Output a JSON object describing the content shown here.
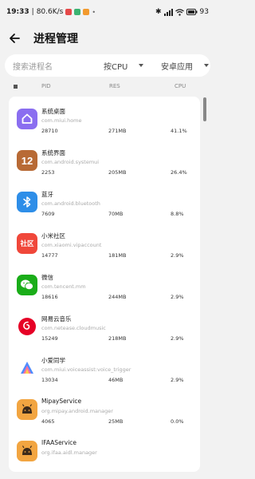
{
  "status": {
    "time": "19:33",
    "speed": "80.6K/s",
    "battery": "93"
  },
  "appbar": {
    "title": "进程管理"
  },
  "filter": {
    "search_placeholder": "搜索进程名",
    "sort_label": "按CPU",
    "type_label": "安卓应用"
  },
  "columns": {
    "pid": "PID",
    "res": "RES",
    "cpu": "CPU"
  },
  "colors": {
    "accent": "#1e88e5",
    "background": "#f2f2f2",
    "card": "#ffffff"
  },
  "processes": [
    {
      "name": "系统桌面",
      "package": "com.miui.home",
      "pid": "28710",
      "res": "271MB",
      "cpu": "41.1%",
      "icon": "home-icon"
    },
    {
      "name": "系统界面",
      "package": "com.android.systemui",
      "pid": "2253",
      "res": "205MB",
      "cpu": "26.4%",
      "icon": "systemui-icon"
    },
    {
      "name": "蓝牙",
      "package": "com.android.bluetooth",
      "pid": "7609",
      "res": "70MB",
      "cpu": "8.8%",
      "icon": "bluetooth-icon"
    },
    {
      "name": "小米社区",
      "package": "com.xiaomi.vipaccount",
      "pid": "14777",
      "res": "181MB",
      "cpu": "2.9%",
      "icon": "community-icon",
      "icon_text": "社区"
    },
    {
      "name": "微信",
      "package": "com.tencent.mm",
      "pid": "18616",
      "res": "244MB",
      "cpu": "2.9%",
      "icon": "wechat-icon"
    },
    {
      "name": "网易云音乐",
      "package": "com.netease.cloudmusic",
      "pid": "15249",
      "res": "218MB",
      "cpu": "2.9%",
      "icon": "music-icon"
    },
    {
      "name": "小爱同学",
      "package": "com.miui.voiceassist:voice_trigger",
      "pid": "13034",
      "res": "46MB",
      "cpu": "2.9%",
      "icon": "voice-assistant-icon"
    },
    {
      "name": "MipayService",
      "package": "org.mipay.android.manager",
      "pid": "4065",
      "res": "25MB",
      "cpu": "0.0%",
      "icon": "android-icon"
    },
    {
      "name": "IFAAService",
      "package": "org.ifaa.aidl.manager",
      "pid": "",
      "res": "",
      "cpu": "",
      "icon": "android-icon"
    }
  ]
}
